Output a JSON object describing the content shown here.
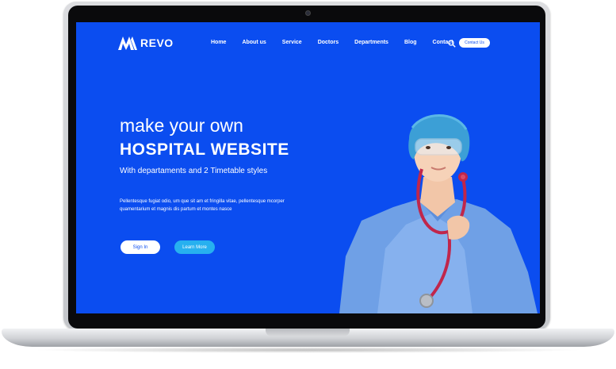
{
  "brand": {
    "name": "REVO"
  },
  "nav": {
    "items": [
      "Home",
      "About us",
      "Service",
      "Doctors",
      "Departments",
      "Blog",
      "Contact"
    ],
    "search_icon": "search-icon",
    "cta": "Contact Us"
  },
  "hero": {
    "subtitle": "make your own",
    "title": "HOSPITAL WEBSITE",
    "tagline": "With departaments and 2 Timetable styles",
    "paragraph": "Pellentesque fugiat odio, um que sit am et fringilla vitae, pellentesque mcorper quamentarium et magnis dis partum et montes nasce"
  },
  "buttons": {
    "signin": "Sign In",
    "learn_more": "Learn More"
  },
  "colors": {
    "background": "#0b4df0",
    "accent": "#27b0ef",
    "text": "#ffffff",
    "scrubs": "#6fa0e6",
    "stethoscope": "#c0264b"
  }
}
